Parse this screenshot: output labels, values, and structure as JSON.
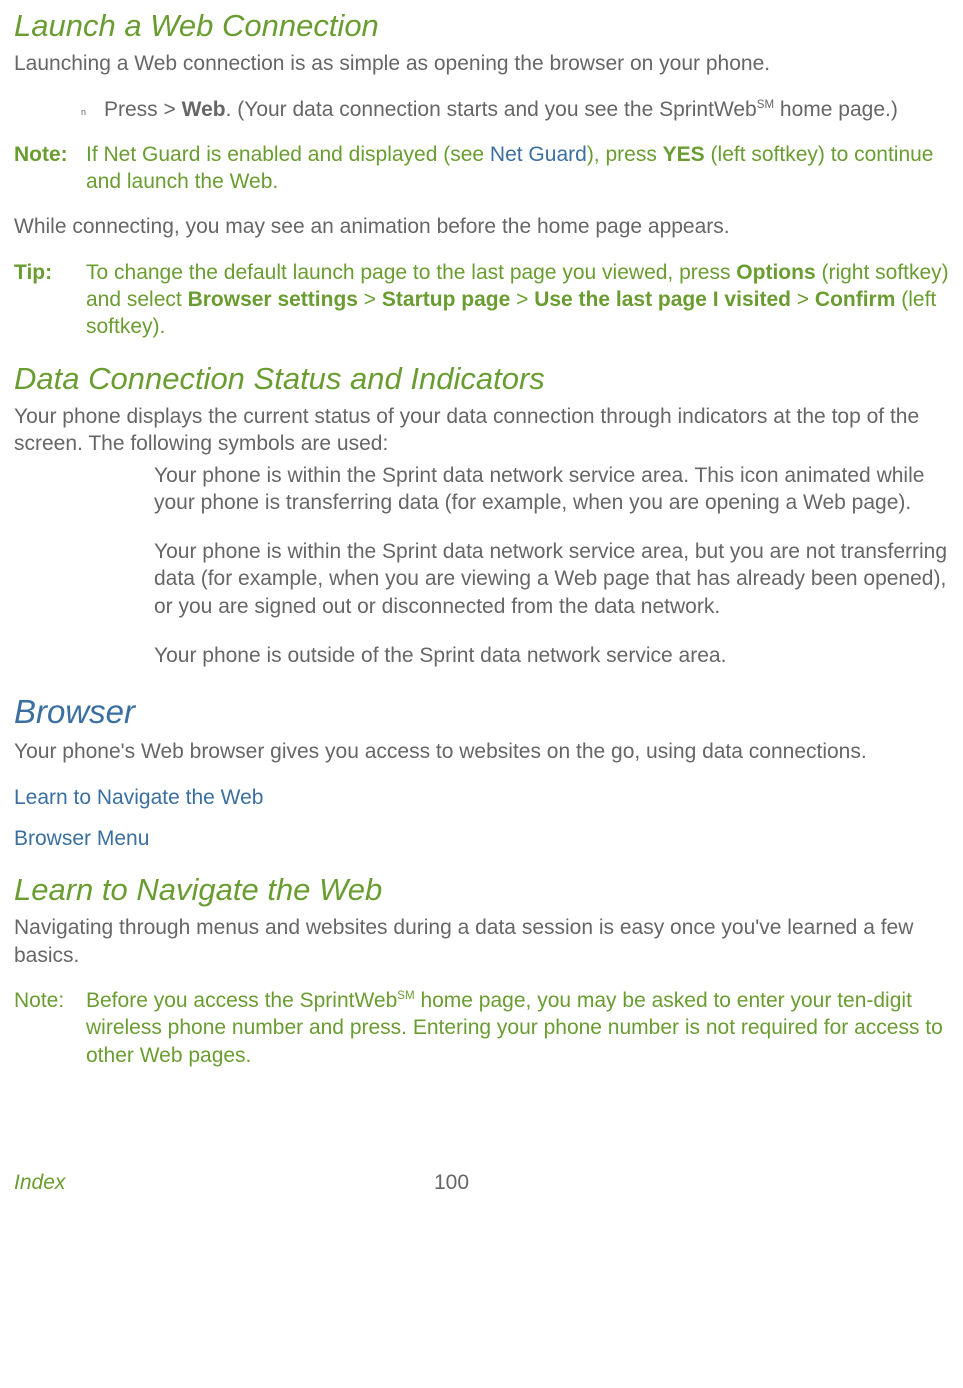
{
  "h1": "Launch a Web Connection",
  "p1": "Launching a Web connection is as simple as opening the browser on your phone.",
  "bullet": {
    "marker": "n",
    "prefix": "Press  > ",
    "bold1": "Web",
    "mid": ". (Your data connection starts and you see the SprintWeb",
    "sup": "SM",
    "end": " home page.)"
  },
  "note1": {
    "label": "Note:",
    "t1": "If Net Guard is enabled and displayed (see ",
    "link": "Net Guard",
    "t2": "), press ",
    "bold": "YES",
    "t3": " (left softkey) to continue and launch the Web."
  },
  "p2": "While connecting, you may see an animation before the home page appears.",
  "tip": {
    "label": "Tip:",
    "t1": "To change the default launch page to the last page you viewed, press ",
    "b1": "Options",
    "t2": " (right softkey) and select ",
    "b2": "Browser settings",
    "t3": " > ",
    "b3": "Startup page",
    "t4": " > ",
    "b4": "Use the last page I visited",
    "t5": " > ",
    "b5": "Confirm",
    "t6": " (left softkey)."
  },
  "h2": "Data Connection Status and Indicators",
  "p3": "Your phone displays the current status of your data connection through indicators at the top of the screen. The following symbols are used:",
  "ind1": "Your phone is within the Sprint data network service area. This icon animated while your phone is transferring data (for example, when you are opening a Web page).",
  "ind2": "Your phone is within the Sprint data network service area, but you are not transferring data (for example, when you are viewing a Web page that has already been opened), or you are signed out or disconnected from the data network.",
  "ind3": "Your phone is outside of the Sprint data network service area.",
  "h3": "Browser",
  "p4": "Your phone's Web browser gives you access to websites on the go, using data connections.",
  "link1": "Learn to Navigate the Web",
  "link2": "Browser Menu",
  "h4": "Learn to Navigate the Web",
  "p5": "Navigating through menus and websites during a data session is easy once you've learned a few basics.",
  "note2": {
    "label": "Note:",
    "t1": "Before you access the SprintWeb",
    "sup": "SM",
    "t2": " home page, you may be asked to enter your ten-digit wireless phone number and press. Entering your phone number is not required for access to other Web pages."
  },
  "footer": {
    "index": "Index",
    "page": "100"
  }
}
